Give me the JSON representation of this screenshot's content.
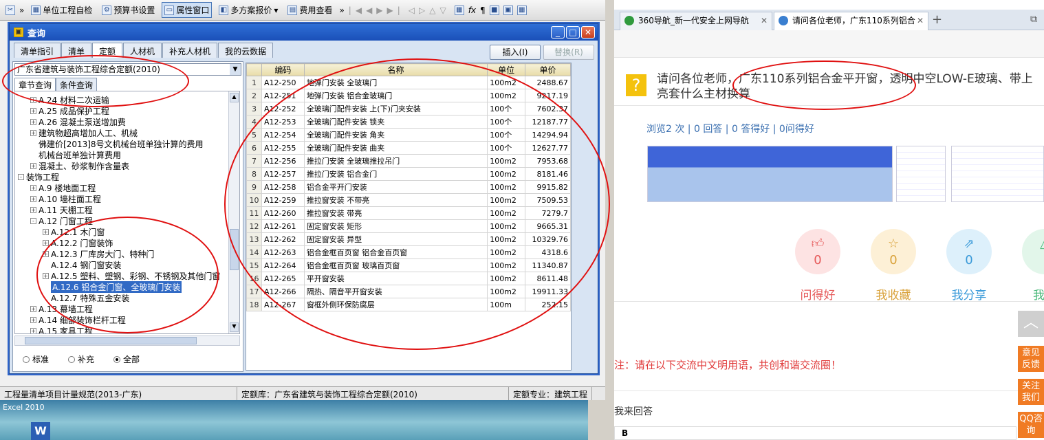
{
  "toolbar": {
    "items": [
      "单位工程自检",
      "预算书设置",
      "属性窗口",
      "多方案报价",
      "费用查看"
    ],
    "active_index": 2
  },
  "status_bar": {
    "spec": "工程量清单项目计量规范(2013-广东)",
    "quota_lib": "定额库：广东省建筑与装饰工程综合定额(2010)",
    "quota_major": "定额专业：建筑工程"
  },
  "taskbar": {
    "excel_label": "Excel 2010"
  },
  "dialog": {
    "title": "查询",
    "tabs": [
      "清单指引",
      "清单",
      "定额",
      "人材机",
      "补充人材机",
      "我的云数据"
    ],
    "active_tab": 2,
    "insert_label": "插入(I)",
    "replace_label": "替换(R)",
    "combo_value": "广东省建筑与装饰工程综合定额(2010)",
    "subtabs": [
      "章节查询",
      "条件查询"
    ],
    "tree": [
      {
        "pm": "+",
        "text": "A.24 材料二次运输",
        "indent": 2
      },
      {
        "pm": "+",
        "text": "A.25 成品保护工程",
        "indent": 2
      },
      {
        "pm": "+",
        "text": "A.26 混凝土泵送增加费",
        "indent": 2
      },
      {
        "pm": "+",
        "text": "建筑物超高增加人工、机械",
        "indent": 2
      },
      {
        "pm": "",
        "text": "佛建价[2013]8号文机械台班单独计算的费用",
        "indent": 2
      },
      {
        "pm": "",
        "text": "机械台班单独计算费用",
        "indent": 2
      },
      {
        "pm": "+",
        "text": "混凝土、砂浆制作含量表",
        "indent": 2
      },
      {
        "pm": "-",
        "text": "装饰工程",
        "indent": 1
      },
      {
        "pm": "+",
        "text": "A.9 楼地面工程",
        "indent": 2
      },
      {
        "pm": "+",
        "text": "A.10 墙柱面工程",
        "indent": 2
      },
      {
        "pm": "+",
        "text": "A.11 天棚工程",
        "indent": 2
      },
      {
        "pm": "-",
        "text": "A.12 门窗工程",
        "indent": 2
      },
      {
        "pm": "+",
        "text": "A.12.1 木门窗",
        "indent": 3
      },
      {
        "pm": "+",
        "text": "A.12.2 门窗装饰",
        "indent": 3
      },
      {
        "pm": "+",
        "text": "A.12.3 厂库房大门、特种门",
        "indent": 3
      },
      {
        "pm": "",
        "text": "A.12.4 钢门窗安装",
        "indent": 3
      },
      {
        "pm": "+",
        "text": "A.12.5 塑料、塑钢、彩钢、不锈钢及其他门窗",
        "indent": 3
      },
      {
        "pm": "",
        "text": "A.12.6 铝合金门窗、全玻璃门安装",
        "indent": 3,
        "selected": true
      },
      {
        "pm": "",
        "text": "A.12.7 特殊五金安装",
        "indent": 3
      },
      {
        "pm": "+",
        "text": "A.13 幕墙工程",
        "indent": 2
      },
      {
        "pm": "+",
        "text": "A.14 细部装饰栏杆工程",
        "indent": 2
      },
      {
        "pm": "+",
        "text": "A.15 家具工程",
        "indent": 2
      }
    ],
    "radios": [
      "标准",
      "补充",
      "全部"
    ],
    "radio_selected": 2,
    "grid": {
      "headers": [
        "编码",
        "名称",
        "单位",
        "单价"
      ],
      "rows": [
        [
          "1",
          "A12-250",
          "地弹门安装 全玻璃门",
          "100m2",
          "2488.67"
        ],
        [
          "2",
          "A12-251",
          "地弹门安装 铝合金玻璃门",
          "100m2",
          "9217.19"
        ],
        [
          "3",
          "A12-252",
          "全玻璃门配件安装 上(下)门夹安装",
          "100个",
          "7602.37"
        ],
        [
          "4",
          "A12-253",
          "全玻璃门配件安装 锁夹",
          "100个",
          "12187.77"
        ],
        [
          "5",
          "A12-254",
          "全玻璃门配件安装 角夹",
          "100个",
          "14294.94"
        ],
        [
          "6",
          "A12-255",
          "全玻璃门配件安装 曲夹",
          "100个",
          "12627.77"
        ],
        [
          "7",
          "A12-256",
          "推拉门安装 全玻璃推拉吊门",
          "100m2",
          "7953.68"
        ],
        [
          "8",
          "A12-257",
          "推拉门安装 铝合金门",
          "100m2",
          "8181.46"
        ],
        [
          "9",
          "A12-258",
          "铝合金平开门安装",
          "100m2",
          "9915.82"
        ],
        [
          "10",
          "A12-259",
          "推拉窗安装 不带亮",
          "100m2",
          "7509.53"
        ],
        [
          "11",
          "A12-260",
          "推拉窗安装 带亮",
          "100m2",
          "7279.7"
        ],
        [
          "12",
          "A12-261",
          "固定窗安装 矩形",
          "100m2",
          "9665.31"
        ],
        [
          "13",
          "A12-262",
          "固定窗安装 异型",
          "100m2",
          "10329.76"
        ],
        [
          "14",
          "A12-263",
          "铝合金框百页窗 铝合金百页窗",
          "100m2",
          "4318.6"
        ],
        [
          "15",
          "A12-264",
          "铝合金框百页窗 玻璃百页窗",
          "100m2",
          "11340.87"
        ],
        [
          "16",
          "A12-265",
          "平开窗安装",
          "100m2",
          "8611.48"
        ],
        [
          "17",
          "A12-266",
          "隔热、隔音平开窗安装",
          "100m2",
          "19911.33"
        ],
        [
          "18",
          "A12-267",
          "窗框外侧环保防腐层",
          "100m",
          "252.15"
        ]
      ]
    }
  },
  "browser": {
    "tabs": [
      "360导航_新一代安全上网导航",
      "请问各位老师，广东110系列铝合"
    ],
    "active_tab": 1,
    "question": "请问各位老师，广东110系列铝合金平开窗，透明中空LOW-E玻璃、带上亮套什么主材换算",
    "stats": "浏览2 次 | 0 回答 | 0 答得好 | 0问得好",
    "actions": [
      {
        "label": "问得好",
        "count": "0",
        "icon": "thumb-up-icon",
        "color": "#e65a5a",
        "bg": "#fde3e3"
      },
      {
        "label": "我收藏",
        "count": "0",
        "icon": "star-icon",
        "color": "#d9a23a",
        "bg": "#fdf0d6"
      },
      {
        "label": "我分享",
        "count": "0",
        "icon": "share-icon",
        "color": "#3a9ad9",
        "bg": "#ddf0fb"
      },
      {
        "label": "我举",
        "count": "",
        "icon": "report-icon",
        "color": "#4ab87a",
        "bg": "#e2f6ea"
      }
    ],
    "side_buttons": [
      "意见反馈",
      "关注我们",
      "QQ咨询"
    ],
    "notice": "注：请在以下交流中文明用语，共创和谐交流圈！",
    "reply_label": "我来回答"
  }
}
